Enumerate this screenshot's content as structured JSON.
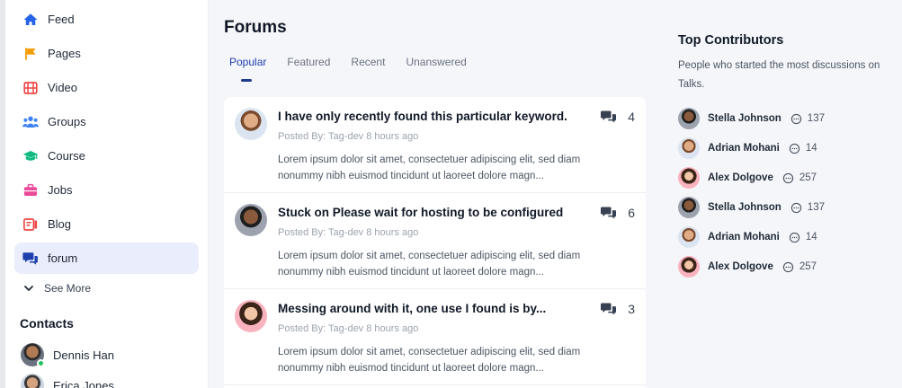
{
  "sidebar": {
    "items": [
      {
        "label": "Feed",
        "icon": "home-icon",
        "color": "#2563eb"
      },
      {
        "label": "Pages",
        "icon": "flag-icon",
        "color": "#f59e0b"
      },
      {
        "label": "Video",
        "icon": "film-icon",
        "color": "#ef4444"
      },
      {
        "label": "Groups",
        "icon": "users-icon",
        "color": "#3b82f6"
      },
      {
        "label": "Course",
        "icon": "graduation-cap-icon",
        "color": "#10b981"
      },
      {
        "label": "Jobs",
        "icon": "briefcase-icon",
        "color": "#ec4899"
      },
      {
        "label": "Blog",
        "icon": "blog-icon",
        "color": "#ef4444"
      },
      {
        "label": "forum",
        "icon": "chat-icon",
        "color": "#1e40af",
        "active": true
      }
    ],
    "see_more": "See More",
    "contacts_title": "Contacts",
    "contacts": [
      {
        "name": "Dennis Han",
        "online": true
      },
      {
        "name": "Erica Jones",
        "online": false
      }
    ]
  },
  "main": {
    "title": "Forums",
    "tabs": [
      "Popular",
      "Featured",
      "Recent",
      "Unanswered"
    ],
    "active_tab": "Popular",
    "threads": [
      {
        "title": "I have only recently found this particular keyword.",
        "meta": "Posted By: Tag-dev 8 hours ago",
        "body": "Lorem ipsum dolor sit amet, consectetuer adipiscing elit, sed diam nonummy nibh euismod tincidunt ut laoreet dolore magn...",
        "count": "4"
      },
      {
        "title": "Stuck on Please wait for hosting to be configured",
        "meta": "Posted By: Tag-dev 8 hours ago",
        "body": "Lorem ipsum dolor sit amet, consectetuer adipiscing elit, sed diam nonummy nibh euismod tincidunt ut laoreet dolore magn...",
        "count": "6"
      },
      {
        "title": "Messing around with it, one use I found is by...",
        "meta": "Posted By: Tag-dev 8 hours ago",
        "body": "Lorem ipsum dolor sit amet, consectetuer adipiscing elit, sed diam nonummy nibh euismod tincidunt ut laoreet dolore magn...",
        "count": "3"
      }
    ]
  },
  "top_contributors": {
    "title": "Top Contributors",
    "description": "People who started the most discussions on Talks.",
    "people": [
      {
        "name": "Stella Johnson",
        "count": "137"
      },
      {
        "name": "Adrian Mohani",
        "count": "14"
      },
      {
        "name": "Alex Dolgove",
        "count": "257"
      },
      {
        "name": "Stella Johnson",
        "count": "137"
      },
      {
        "name": "Adrian Mohani",
        "count": "14"
      },
      {
        "name": "Alex Dolgove",
        "count": "257"
      }
    ]
  },
  "colors": {
    "accent": "#1e40af",
    "active_nav_bg": "#eaedfb",
    "page_bg": "#f5f6f9"
  }
}
